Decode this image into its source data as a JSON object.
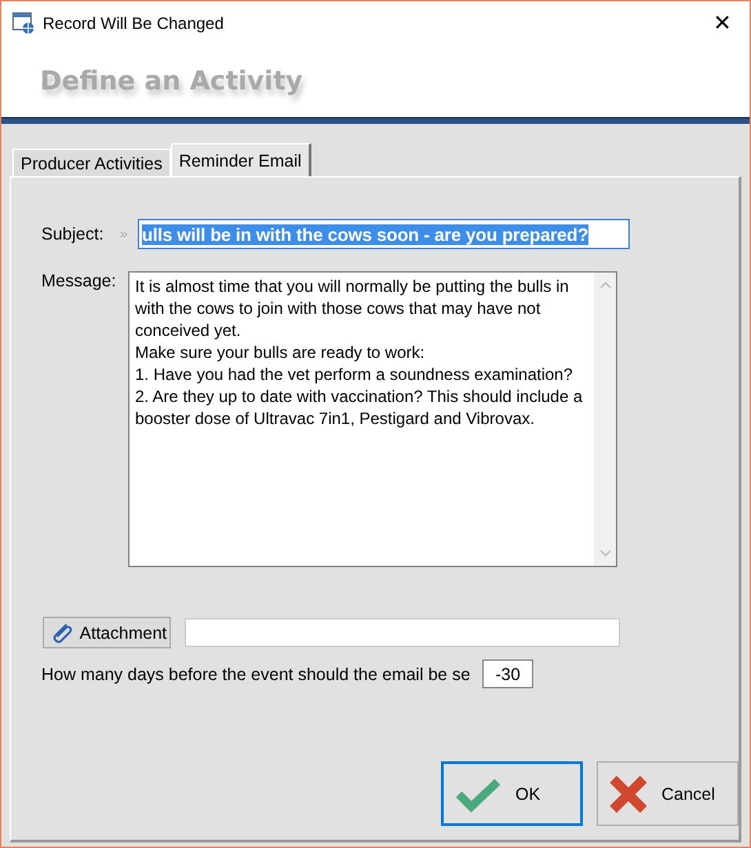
{
  "window": {
    "title": "Record Will Be Changed",
    "close": "✕"
  },
  "header": {
    "title": "Define an Activity"
  },
  "tabs": [
    {
      "label": "Producer Activities",
      "selected": false
    },
    {
      "label": "Reminder Email",
      "selected": true
    }
  ],
  "subject": {
    "label": "Subject:",
    "marker": "»",
    "value": "ulls will be in with the cows soon - are you prepared?",
    "text_selected": true
  },
  "message": {
    "label": "Message:",
    "value": "It is almost time that you will normally be putting the bulls in with the cows to join with those cows that may have not conceived yet.\nMake sure your bulls are ready to work:\n1. Have you had the vet perform a soundness examination?\n2. Are they up to date with vaccination? This should include a booster dose of Ultravac 7in1, Pestigard and Vibrovax."
  },
  "attachment": {
    "button": "Attachment"
  },
  "days": {
    "label": "How many days before the event should the email be se",
    "value": "-30"
  },
  "buttons": [
    {
      "kind": "ok",
      "label": "OK",
      "focused": true
    },
    {
      "kind": "cancel",
      "label": "Cancel",
      "focused": false
    }
  ]
}
